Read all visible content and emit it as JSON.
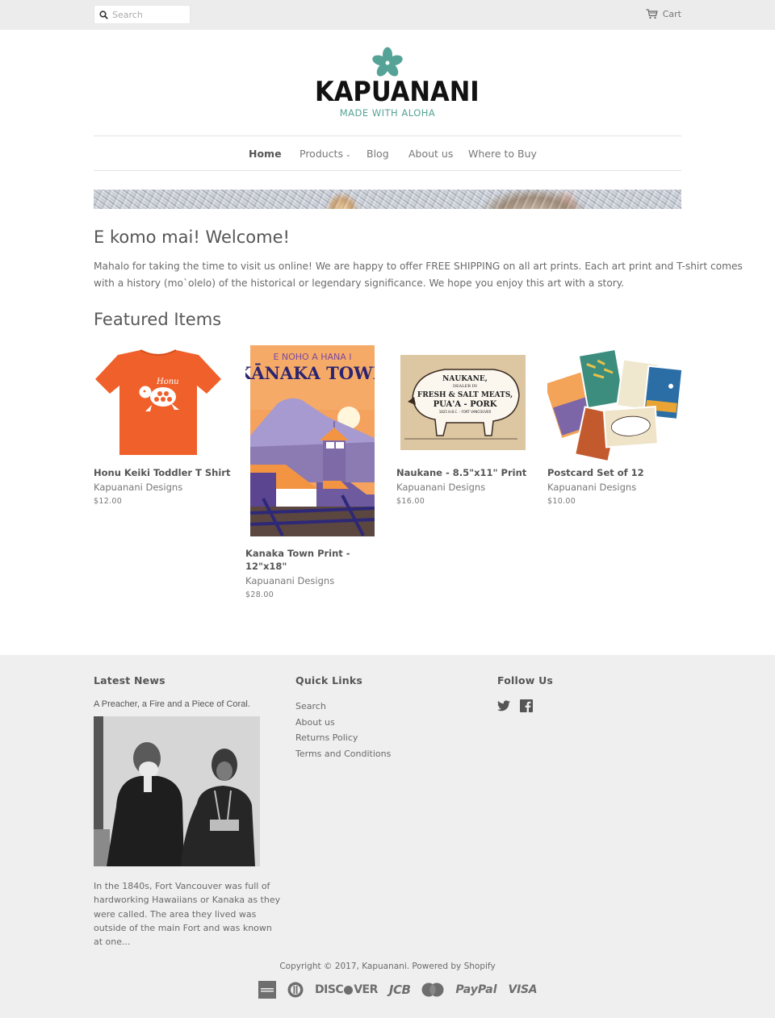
{
  "topbar": {
    "search_placeholder": "Search",
    "cart_label": "Cart"
  },
  "brand": {
    "name": "KAPUANANI",
    "tagline": "MADE WITH ALOHA",
    "accent_color": "#55a396"
  },
  "nav": {
    "items": [
      {
        "label": "Home",
        "active": true
      },
      {
        "label": "Products",
        "has_dropdown": true,
        "chevron": "⌄"
      },
      {
        "label": "Blog"
      },
      {
        "label": "About us"
      },
      {
        "label": "Where to Buy"
      }
    ]
  },
  "welcome": {
    "title": "E komo mai! Welcome!",
    "body": "Mahalo for taking the time to visit us online! We are happy to offer FREE SHIPPING on all art prints.  Each art print and T-shirt comes with a history (mo`olelo) of the historical or legendary significance. We hope you enjoy this art with a story."
  },
  "featured": {
    "title": "Featured Items",
    "products": [
      {
        "name": "Honu Keiki Toddler T Shirt",
        "vendor": "Kapuanani Designs",
        "price": "$12.00",
        "image_text": "Honu"
      },
      {
        "name": "Kanaka Town Print - 12\"x18\"",
        "vendor": "Kapuanani Designs",
        "price": "$28.00",
        "image_text_top": "E NOHO A HANA I",
        "image_text_main": "KĀNAKA TOWN"
      },
      {
        "name": "Naukane - 8.5\"x11\" Print",
        "vendor": "Kapuanani Designs",
        "price": "$16.00",
        "image_text_1": "NAUKANE,",
        "image_text_2": "DEALER IN",
        "image_text_3": "FRESH & SALT MEATS,",
        "image_text_4": "PUA'A - PORK",
        "image_text_5": "1825 H.B.C. - FORT VANCOUVER"
      },
      {
        "name": "Postcard Set of 12",
        "vendor": "Kapuanani Designs",
        "price": "$10.00"
      }
    ]
  },
  "footer": {
    "latest_news": {
      "title": "Latest News",
      "post_title": "A Preacher, a Fire and a Piece of Coral.",
      "excerpt": "In the 1840s, Fort Vancouver was full of hardworking Hawaiians or Kanaka as they were called. The area they lived was outside of the main Fort and was known at one..."
    },
    "quick_links": {
      "title": "Quick Links",
      "items": [
        "Search",
        "About us",
        "Returns Policy",
        "Terms and Conditions"
      ]
    },
    "follow_us": {
      "title": "Follow Us",
      "networks": [
        "twitter-icon",
        "facebook-icon"
      ]
    },
    "copyright": "Copyright © 2017, Kapuanani. Powered by Shopify",
    "payment_methods": [
      "American Express",
      "Diners Club",
      "DISCOVER",
      "JCB",
      "MasterCard",
      "PayPal",
      "VISA"
    ],
    "payment_labels": {
      "discover": "DISC",
      "discover_end": "VER",
      "jcb": "JCB",
      "paypal": "PayPal",
      "visa": "VISA"
    }
  }
}
